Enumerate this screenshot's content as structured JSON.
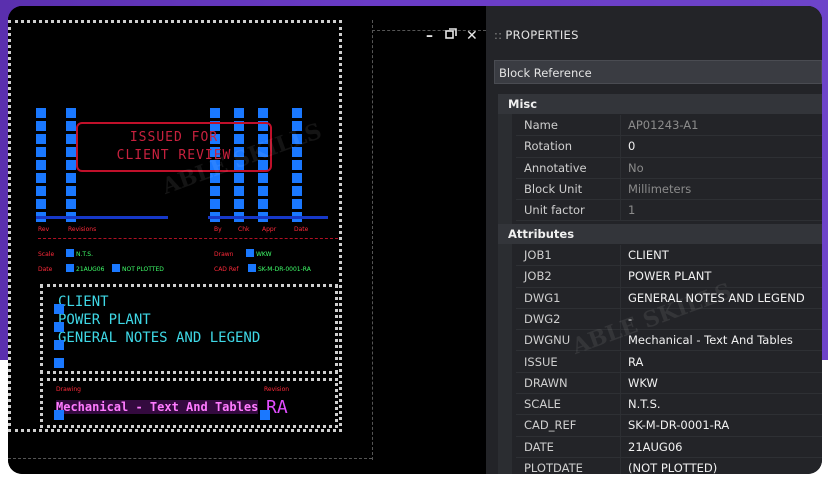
{
  "window_controls": {
    "minimize": "–",
    "restore": "▫",
    "close": "✕"
  },
  "cad": {
    "stamp_line1": "ISSUED FOR",
    "stamp_line2": "CLIENT REVIEW",
    "col_labels": [
      "Rev",
      "Revisions",
      "By",
      "Chk",
      "Appr",
      "Date"
    ],
    "row1_left_label": "Scale",
    "row1_left_value": "N.T.S.",
    "row1_right_label": "Drawn",
    "row1_right_value": "WKW",
    "row2_left_label": "Date",
    "row2_left_value": "21AUG06",
    "row2_mid_value": "NOT PLOTTED",
    "row2_right_label": "CAD Ref",
    "row2_right_value": "SK-M-DR-0001-RA",
    "title_line1": "CLIENT",
    "title_line2": "POWER PLANT",
    "title_line3": "GENERAL NOTES AND LEGEND",
    "drawing_label": "Drawing",
    "revision_label": "Revision",
    "drawing_value": "Mechanical - Text And Tables",
    "revision_value": "RA"
  },
  "properties": {
    "title": "PROPERTIES",
    "grip": "::",
    "selector_value": "Block Reference",
    "misc_header": "Misc",
    "misc": [
      {
        "key": "Name",
        "value": "AP01243-A1",
        "dim": true
      },
      {
        "key": "Rotation",
        "value": "0",
        "dim": false
      },
      {
        "key": "Annotative",
        "value": "No",
        "dim": true
      },
      {
        "key": "Block Unit",
        "value": "Millimeters",
        "dim": true
      },
      {
        "key": "Unit factor",
        "value": "1",
        "dim": true
      }
    ],
    "attributes_header": "Attributes",
    "attributes": [
      {
        "key": "JOB1",
        "value": "CLIENT"
      },
      {
        "key": "JOB2",
        "value": "POWER PLANT"
      },
      {
        "key": "DWG1",
        "value": "GENERAL NOTES AND LEGEND"
      },
      {
        "key": "DWG2",
        "value": "-"
      },
      {
        "key": "DWGNU",
        "value": "Mechanical - Text And Tables"
      },
      {
        "key": "ISSUE",
        "value": "RA"
      },
      {
        "key": "DRAWN",
        "value": "WKW"
      },
      {
        "key": "SCALE",
        "value": "N.T.S."
      },
      {
        "key": "CAD_REF",
        "value": "SK-M-DR-0001-RA"
      },
      {
        "key": "DATE",
        "value": "21AUG06"
      },
      {
        "key": "PLOTDATE",
        "value": "(NOT PLOTTED)"
      }
    ]
  },
  "colors": {
    "accent_purple": "#6a3bc6",
    "grip_blue": "#1a78ff",
    "panel_bg": "#232428"
  }
}
